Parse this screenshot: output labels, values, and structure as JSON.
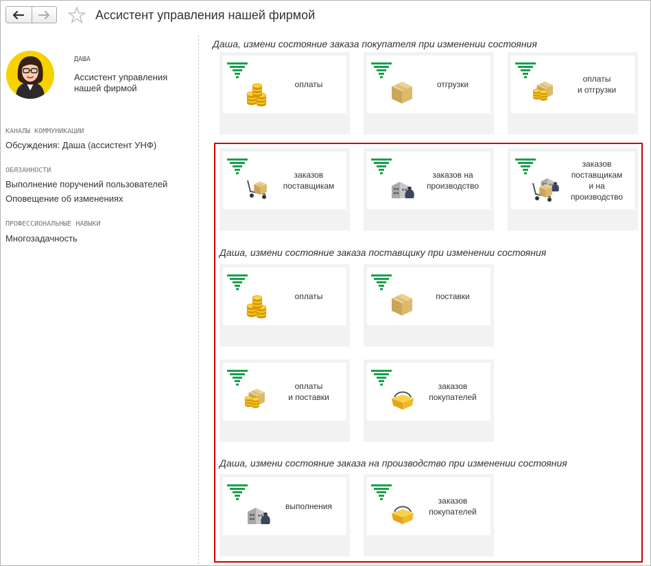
{
  "header": {
    "title": "Ассистент управления нашей фирмой"
  },
  "profile": {
    "name": "ДАША",
    "role": "Ассистент управления нашей фирмой"
  },
  "sections_left": {
    "channels": {
      "heading": "КАНАЛЫ КОММУНИКАЦИИ",
      "items": [
        "Обсуждения: Даша (ассистент УНФ)"
      ]
    },
    "duties": {
      "heading": "ОБЯЗАННОСТИ",
      "items": [
        "Выполнение поручений пользователей",
        "Оповещение об изменениях"
      ]
    },
    "skills": {
      "heading": "ПРОФЕССИОНАЛЬНЫЕ НАВЫКИ",
      "items": [
        "Многозадачность"
      ]
    }
  },
  "groups": {
    "customer_orders": {
      "title": "Даша, измени состояние заказа покупателя при изменении состояния",
      "cards": [
        {
          "lines": [
            "оплаты"
          ],
          "icon": "coins-icon"
        },
        {
          "lines": [
            "отгрузки"
          ],
          "icon": "box-icon"
        },
        {
          "lines": [
            "оплаты",
            "и отгрузки"
          ],
          "icon": "box-coins-icon"
        },
        {
          "lines": [
            "заказов",
            "поставщикам"
          ],
          "icon": "pallet-truck-icon"
        },
        {
          "lines": [
            "заказов на",
            "производство"
          ],
          "icon": "factory-icon"
        },
        {
          "lines": [
            "заказов",
            "поставщикам",
            "и на",
            "производство"
          ],
          "icon": "pallet-factory-icon"
        }
      ]
    },
    "supplier_orders": {
      "title": "Даша, измени состояние заказа поставщику при изменении состояния",
      "cards": [
        {
          "lines": [
            "оплаты"
          ],
          "icon": "coins-icon"
        },
        {
          "lines": [
            "поставки"
          ],
          "icon": "box-icon"
        },
        {
          "lines": [
            "оплаты",
            "и поставки"
          ],
          "icon": "box-coins-icon"
        },
        {
          "lines": [
            "заказов",
            "покупателей"
          ],
          "icon": "basket-icon"
        }
      ]
    },
    "production_orders": {
      "title": "Даша, измени состояние заказа на производство при изменении состояния",
      "cards": [
        {
          "lines": [
            "выполнения"
          ],
          "icon": "factory-icon"
        },
        {
          "lines": [
            "заказов",
            "покупателей"
          ],
          "icon": "basket-icon"
        }
      ]
    }
  },
  "colors": {
    "funnel": "#18a04a",
    "highlight_border": "#cc0000",
    "avatar_bg": "#f5d200"
  }
}
